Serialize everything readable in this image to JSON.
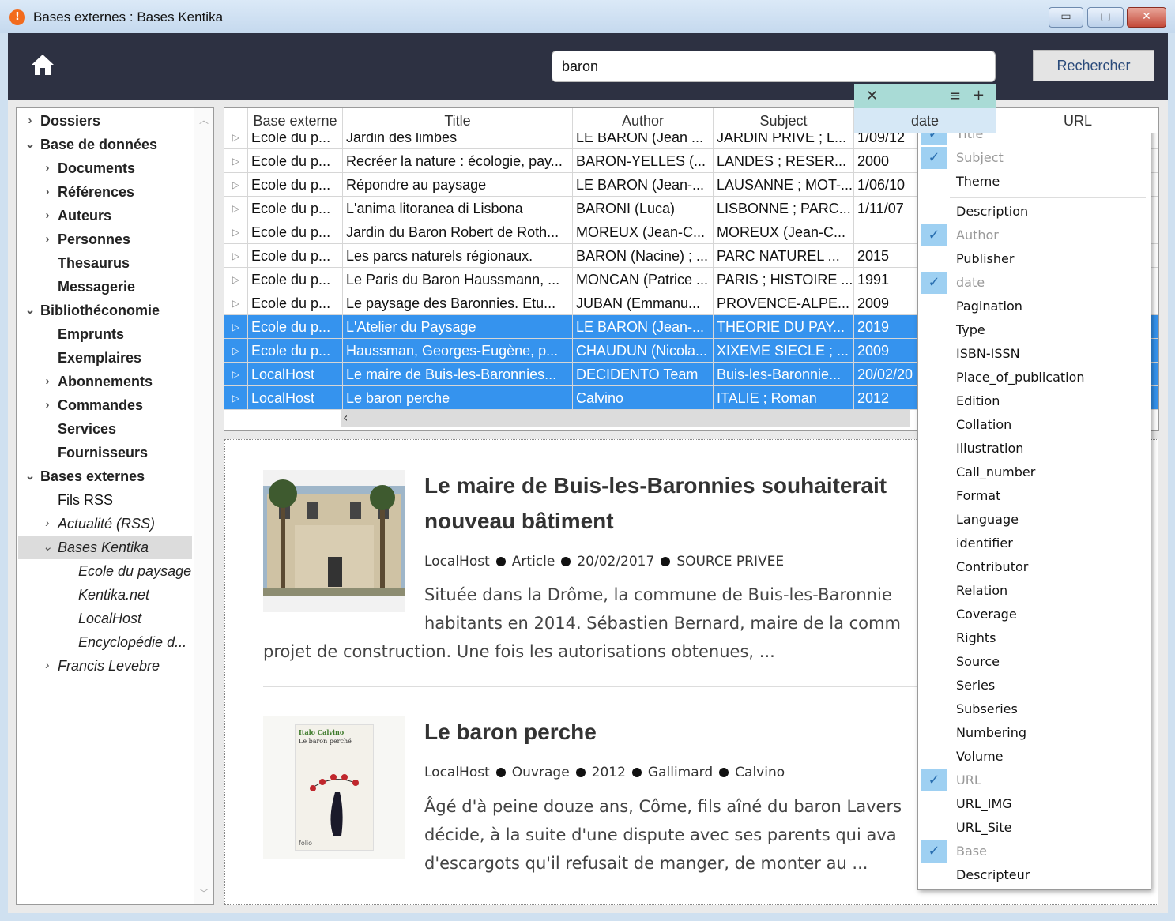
{
  "window": {
    "title": "Bases externes : Bases Kentika",
    "minimize": "▭",
    "maximize": "▢",
    "close": "✕"
  },
  "toolbar": {
    "search_value": "baron",
    "search_button": "Rechercher"
  },
  "sidebar": {
    "items": [
      {
        "label": "Dossiers",
        "chev": "›",
        "level": 0,
        "style": "bold"
      },
      {
        "label": "Base de données",
        "chev": "⌄",
        "level": 0,
        "style": "bold"
      },
      {
        "label": "Documents",
        "chev": "›",
        "level": 1,
        "style": "bold"
      },
      {
        "label": "Références",
        "chev": "›",
        "level": 1,
        "style": "bold"
      },
      {
        "label": "Auteurs",
        "chev": "›",
        "level": 1,
        "style": "bold"
      },
      {
        "label": "Personnes",
        "chev": "›",
        "level": 1,
        "style": "bold"
      },
      {
        "label": "Thesaurus",
        "chev": "",
        "level": 1,
        "style": "bold"
      },
      {
        "label": "Messagerie",
        "chev": "",
        "level": 1,
        "style": "bold"
      },
      {
        "label": "Bibliothéconomie",
        "chev": "⌄",
        "level": 0,
        "style": "bold"
      },
      {
        "label": "Emprunts",
        "chev": "",
        "level": 1,
        "style": "bold"
      },
      {
        "label": "Exemplaires",
        "chev": "",
        "level": 1,
        "style": "bold"
      },
      {
        "label": "Abonnements",
        "chev": "›",
        "level": 1,
        "style": "bold"
      },
      {
        "label": "Commandes",
        "chev": "›",
        "level": 1,
        "style": "bold"
      },
      {
        "label": "Services",
        "chev": "",
        "level": 1,
        "style": "bold"
      },
      {
        "label": "Fournisseurs",
        "chev": "",
        "level": 1,
        "style": "bold"
      },
      {
        "label": "Bases externes",
        "chev": "⌄",
        "level": 0,
        "style": "bold"
      },
      {
        "label": "Fils RSS",
        "chev": "",
        "level": 1,
        "style": "normal"
      },
      {
        "label": "Actualité (RSS)",
        "chev": "›",
        "level": 1,
        "style": "it"
      },
      {
        "label": "Bases Kentika",
        "chev": "⌄",
        "level": 1,
        "style": "it",
        "selected": true
      },
      {
        "label": "Ecole du paysage",
        "chev": "",
        "level": 2,
        "style": "it"
      },
      {
        "label": "Kentika.net",
        "chev": "",
        "level": 2,
        "style": "it"
      },
      {
        "label": "LocalHost",
        "chev": "",
        "level": 2,
        "style": "it"
      },
      {
        "label": "Encyclopédie d...",
        "chev": "",
        "level": 2,
        "style": "it"
      },
      {
        "label": "Francis Levebre",
        "chev": "›",
        "level": 1,
        "style": "it"
      }
    ]
  },
  "grid": {
    "headers": [
      "Base externe",
      "Title",
      "Author",
      "Subject",
      "date",
      "URL"
    ],
    "partial_row": [
      "Ecole du p...",
      "Jardin des limbes",
      "LE BARON (Jean ...",
      "JARDIN PRIVE ; L...",
      "1/09/12"
    ],
    "rows": [
      {
        "cells": [
          "Ecole du p...",
          "Recréer la nature : écologie, pay...",
          "BARON-YELLES (...",
          "LANDES ; RESER...",
          "2000"
        ],
        "selected": false
      },
      {
        "cells": [
          "Ecole du p...",
          "Répondre au paysage",
          "LE BARON (Jean-...",
          "LAUSANNE ; MOT-...",
          "1/06/10"
        ],
        "selected": false
      },
      {
        "cells": [
          "Ecole du p...",
          "L'anima litoranea di Lisbona",
          "BARONI (Luca)",
          "LISBONNE ; PARC...",
          "1/11/07"
        ],
        "selected": false
      },
      {
        "cells": [
          "Ecole du p...",
          "Jardin du Baron Robert de Roth...",
          "MOREUX (Jean-C...",
          "MOREUX (Jean-C...",
          ""
        ],
        "selected": false
      },
      {
        "cells": [
          "Ecole du p...",
          "Les parcs naturels régionaux.",
          "BARON (Nacine) ; ...",
          "PARC NATUREL ...",
          "2015"
        ],
        "selected": false
      },
      {
        "cells": [
          "Ecole du p...",
          "Le Paris du Baron Haussmann, ...",
          "MONCAN (Patrice ...",
          "PARIS ; HISTOIRE ...",
          "1991"
        ],
        "selected": false
      },
      {
        "cells": [
          "Ecole du p...",
          "Le paysage des Baronnies. Etu...",
          "JUBAN (Emmanu...",
          "PROVENCE-ALPE...",
          "2009"
        ],
        "selected": false
      },
      {
        "cells": [
          "Ecole du p...",
          "L'Atelier du Paysage",
          "LE BARON (Jean-...",
          "THEORIE DU PAY...",
          "2019"
        ],
        "selected": true
      },
      {
        "cells": [
          "Ecole du p...",
          "Haussman, Georges-Eugène, p...",
          "CHAUDUN (Nicola...",
          "XIXEME SIECLE ; ...",
          "2009"
        ],
        "selected": true
      },
      {
        "cells": [
          "LocalHost",
          "Le maire de Buis-les-Baronnies...",
          "DECIDENTO Team",
          "Buis-les-Baronnie...",
          "20/02/20"
        ],
        "selected": true
      },
      {
        "cells": [
          "LocalHost",
          "Le baron perche",
          "Calvino",
          "ITALIE ; Roman",
          "2012"
        ],
        "selected": true
      }
    ]
  },
  "column_toolbar": {
    "close": "✕",
    "menu": "≡",
    "add": "+"
  },
  "preview": {
    "cards": [
      {
        "title_lines": [
          "Le maire de Buis-les-Baronnies souhaiterait",
          "nouveau bâtiment"
        ],
        "meta": [
          "LocalHost",
          "Article",
          "20/02/2017",
          "SOURCE PRIVEE"
        ],
        "body_lines": [
          "Située dans la Drôme, la commune de Buis-les-Baronnie",
          "habitants en 2014. Sébastien Bernard, maire de la comm",
          "projet de construction. Une fois les autorisations obtenues, ..."
        ]
      },
      {
        "title_lines": [
          "Le baron perche"
        ],
        "meta": [
          "LocalHost",
          "Ouvrage",
          "2012",
          "Gallimard",
          "Calvino"
        ],
        "body_lines": [
          "Âgé d'à peine douze ans, Côme, fils aîné du baron Lavers",
          "décide, à la suite d'une dispute avec ses parents qui ava",
          "d'escargots qu'il refusait de manger, de monter au ..."
        ],
        "cover_author": "Italo Calvino",
        "cover_title": "Le baron perché",
        "cover_publisher": "folio"
      }
    ]
  },
  "column_menu": {
    "items": [
      {
        "label": "Title",
        "checked": true
      },
      {
        "label": "Subject",
        "checked": true
      },
      {
        "label": "Theme",
        "checked": false
      },
      {
        "label": "Description",
        "checked": false
      },
      {
        "label": "Author",
        "checked": true
      },
      {
        "label": "Publisher",
        "checked": false
      },
      {
        "label": "date",
        "checked": true
      },
      {
        "label": "Pagination",
        "checked": false
      },
      {
        "label": "Type",
        "checked": false
      },
      {
        "label": "ISBN-ISSN",
        "checked": false
      },
      {
        "label": "Place_of_publication",
        "checked": false
      },
      {
        "label": "Edition",
        "checked": false
      },
      {
        "label": "Collation",
        "checked": false
      },
      {
        "label": "Illustration",
        "checked": false
      },
      {
        "label": "Call_number",
        "checked": false
      },
      {
        "label": "Format",
        "checked": false
      },
      {
        "label": "Language",
        "checked": false
      },
      {
        "label": "identifier",
        "checked": false
      },
      {
        "label": "Contributor",
        "checked": false
      },
      {
        "label": "Relation",
        "checked": false
      },
      {
        "label": "Coverage",
        "checked": false
      },
      {
        "label": "Rights",
        "checked": false
      },
      {
        "label": "Source",
        "checked": false
      },
      {
        "label": "Series",
        "checked": false
      },
      {
        "label": "Subseries",
        "checked": false
      },
      {
        "label": "Numbering",
        "checked": false
      },
      {
        "label": "Volume",
        "checked": false
      },
      {
        "label": "URL",
        "checked": true
      },
      {
        "label": "URL_IMG",
        "checked": false
      },
      {
        "label": "URL_Site",
        "checked": false
      },
      {
        "label": "Base",
        "checked": true
      },
      {
        "label": "Descripteur",
        "checked": false
      }
    ]
  },
  "colors": {
    "selection": "#3593ee",
    "toolbar": "#2d3142",
    "check_bg": "#9ed0f2"
  }
}
